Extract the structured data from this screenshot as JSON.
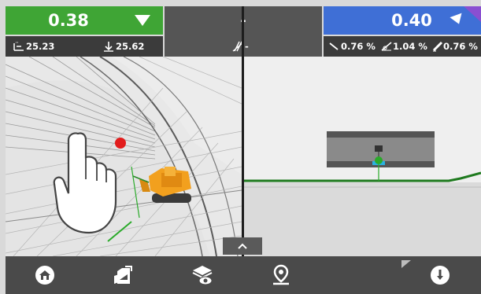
{
  "topbar": {
    "left": {
      "value": "0.38",
      "sub_left": "25.23",
      "sub_right": "25.62",
      "color": "#3fa535"
    },
    "middle": {
      "value": "-",
      "sub": "-"
    },
    "right": {
      "value": "0.40",
      "slope1": "0.76 %",
      "slope2": "1.04 %",
      "slope3": "0.76 %",
      "color": "#3f6fd6"
    }
  },
  "views": {
    "left": {
      "name": "3D view",
      "hint_icon": "touch-gesture-icon"
    },
    "right": {
      "name": "Cross-section view"
    }
  },
  "toolbar": {
    "icons": [
      "home-icon",
      "design-file-icon",
      "view-settings-icon",
      "location-pin-icon",
      "alert-icon"
    ]
  }
}
